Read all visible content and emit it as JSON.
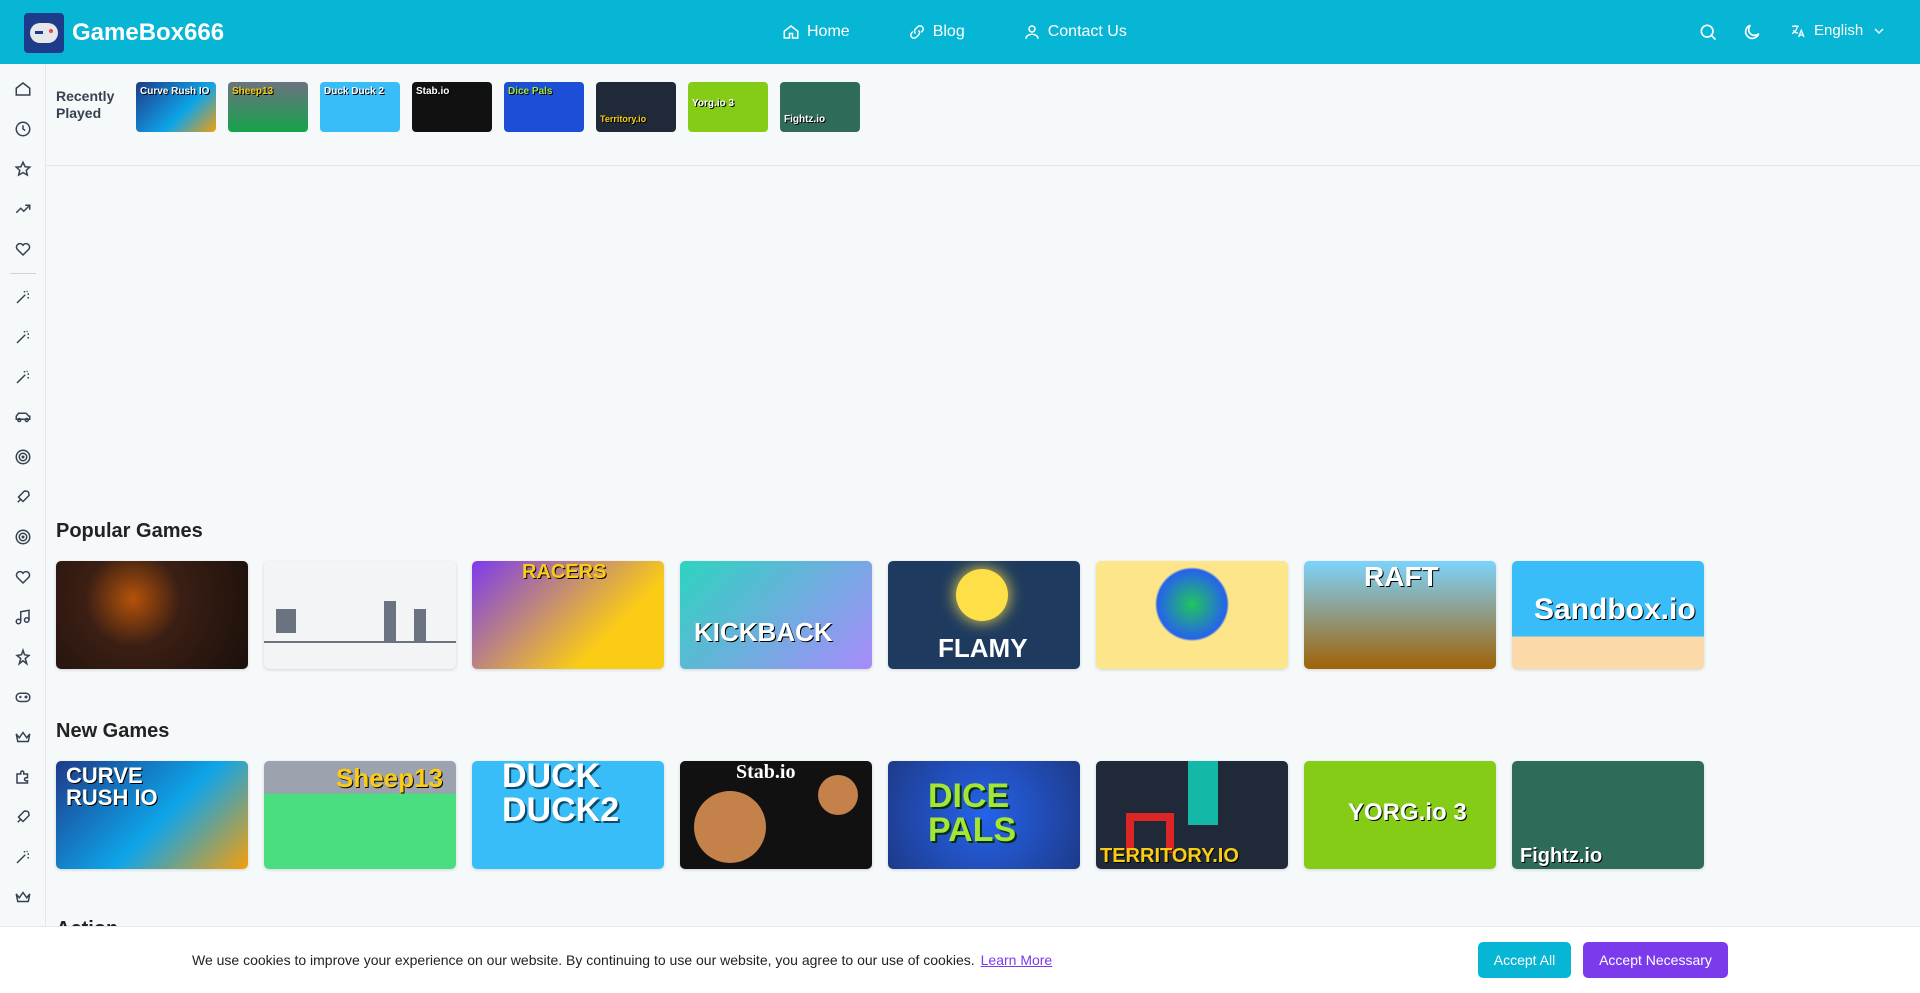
{
  "header": {
    "brand": "GameBox666",
    "nav": [
      {
        "label": "Home",
        "icon": "home-icon"
      },
      {
        "label": "Blog",
        "icon": "link-icon"
      },
      {
        "label": "Contact Us",
        "icon": "user-icon"
      }
    ],
    "language": "English"
  },
  "sidebar": {
    "icons": [
      "home-icon",
      "clock-icon",
      "star-icon",
      "trending-icon",
      "heart-icon",
      "wand-icon",
      "wand-icon",
      "wand-icon",
      "car-icon",
      "target-icon",
      "rocket-icon",
      "target-icon",
      "heart-icon",
      "music-icon",
      "puzzle-icon",
      "gamepad-icon",
      "crown-icon",
      "puzzle-icon",
      "rocket-icon",
      "wand-icon",
      "crown-icon"
    ]
  },
  "recent": {
    "label": "Recently Played",
    "games": [
      "Curve Rush IO",
      "Sheep13",
      "Duck Duck 2",
      "Stab.io",
      "Dice Pals",
      "Territory.io",
      "Yorg.io 3",
      "Fightz.io"
    ]
  },
  "popular": {
    "title": "Popular Games",
    "games": [
      {
        "name": "horror game",
        "text": "",
        "bg": "#2a1a14"
      },
      {
        "name": "dino run",
        "text": "",
        "bg": "#f3f4f6"
      },
      {
        "name": "racers",
        "text": "RACERS",
        "bg": "#facc15"
      },
      {
        "name": "kickback dash",
        "text": "KICKBACK",
        "bg": "#2dd4bf"
      },
      {
        "name": "flamy",
        "text": "FLAMY",
        "bg": "#1e3a5f"
      },
      {
        "name": "globe game",
        "text": "",
        "bg": "#fde68a"
      },
      {
        "name": "raft",
        "text": "RAFT",
        "bg": "#7dd3fc"
      },
      {
        "name": "sandbox.io",
        "text": "Sandbox.io",
        "bg": "#38bdf8"
      }
    ]
  },
  "new_games": {
    "title": "New Games",
    "games": [
      {
        "name": "curve rush io",
        "text": "CURVE RUSH IO",
        "bg": "#1e3a8a"
      },
      {
        "name": "sheep13",
        "text": "Sheep13",
        "bg": "#4ade80"
      },
      {
        "name": "duck duck 2",
        "text": "DUCK DUCK2",
        "bg": "#38bdf8"
      },
      {
        "name": "stab.io",
        "text": "Stab.io",
        "bg": "#111111"
      },
      {
        "name": "dice pals",
        "text": "DICE PALS",
        "bg": "#1d4ed8"
      },
      {
        "name": "territory.io",
        "text": "TERRITORY.IO",
        "bg": "#1f2937"
      },
      {
        "name": "yorg.io 3",
        "text": "YORG.io 3",
        "bg": "#84cc16"
      },
      {
        "name": "fightz.io",
        "text": "Fightz.io",
        "bg": "#2f6b5a"
      }
    ]
  },
  "next_section_title": "Action",
  "cookie": {
    "text": "We use cookies to improve your experience on our website. By continuing to use our website, you agree to our use of cookies.",
    "link": "Learn More",
    "accept_all": "Accept All",
    "accept_necessary": "Accept Necessary"
  },
  "colors": {
    "header": "#06b6d4",
    "accent_purple": "#7c3aed"
  }
}
